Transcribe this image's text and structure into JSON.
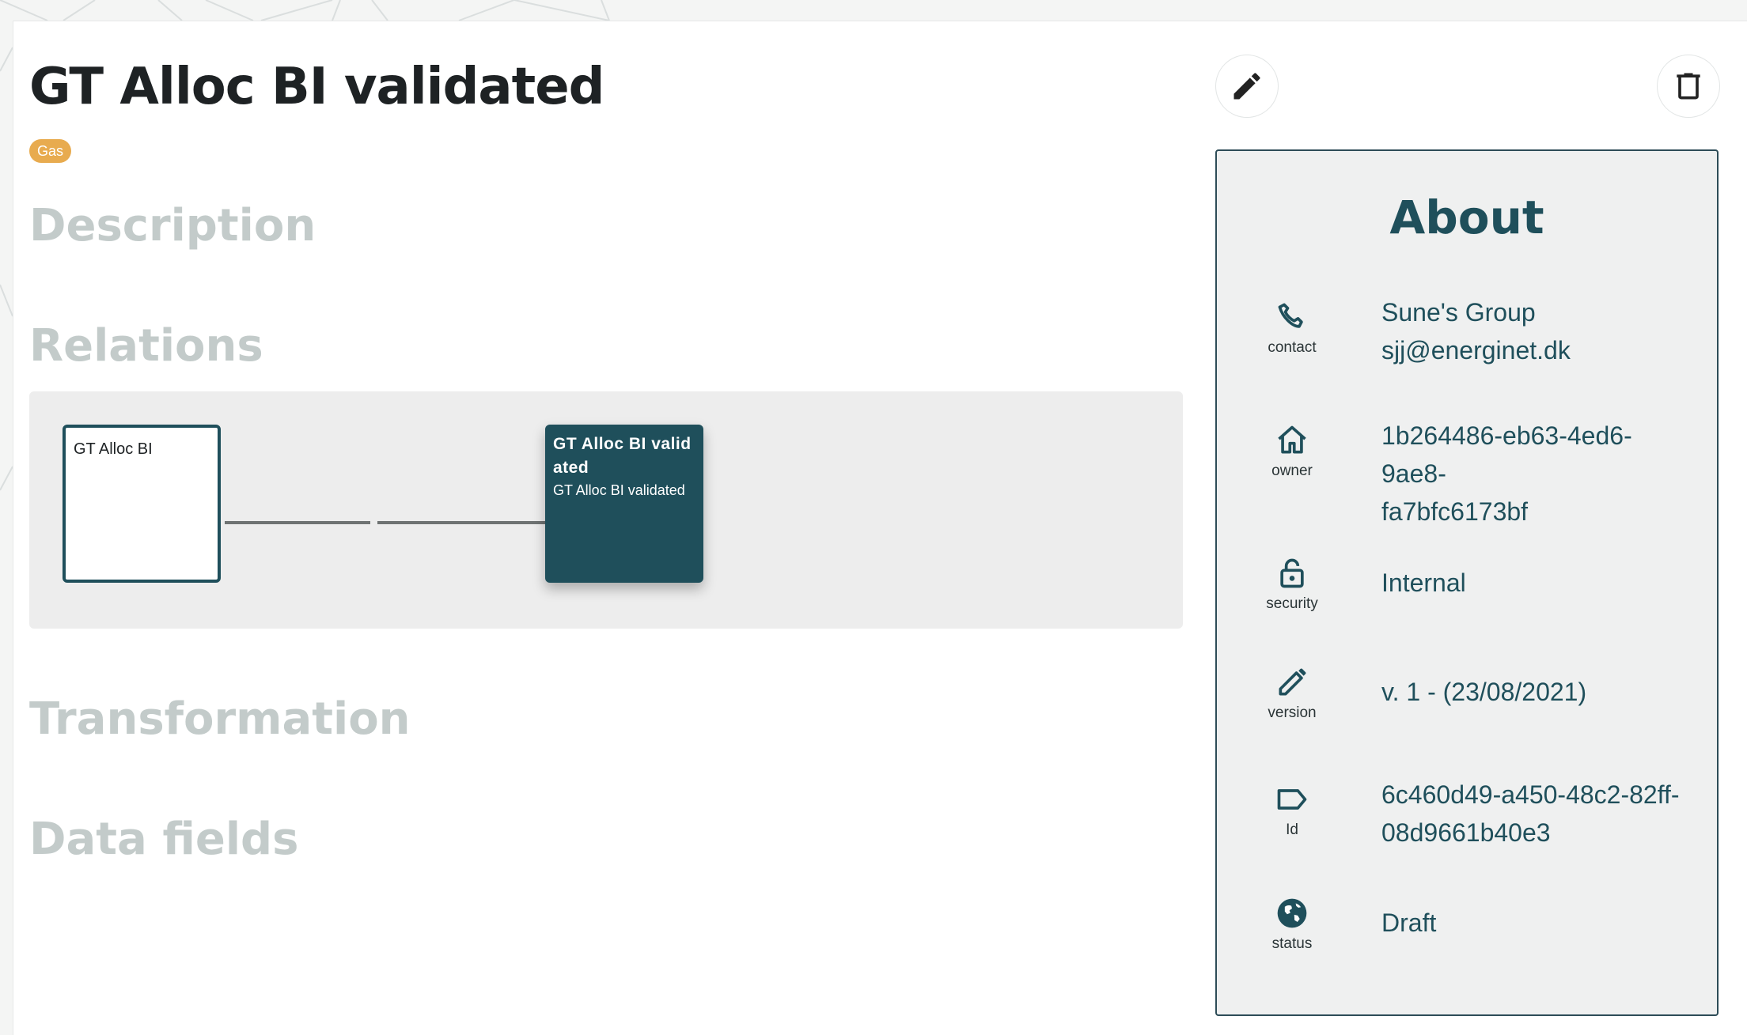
{
  "page": {
    "title": "GT Alloc BI validated",
    "tag": "Gas",
    "sections": {
      "description": "Description",
      "relations": "Relations",
      "transformation": "Transformation",
      "data_fields": "Data fields"
    }
  },
  "lineage": {
    "source_node": {
      "label": "GT Alloc BI"
    },
    "target_node": {
      "title": "GT Alloc BI validated",
      "subtitle": "GT Alloc BI validated"
    }
  },
  "actions": {
    "edit_icon": "pencil-icon",
    "delete_icon": "trash-icon"
  },
  "about": {
    "title": "About",
    "contact": {
      "label": "contact",
      "icon": "phone-icon",
      "line1": "Sune's Group",
      "line2": "sjj@energinet.dk"
    },
    "owner": {
      "label": "owner",
      "icon": "home-icon",
      "line1": "1b264486-eb63-4ed6-9ae8-",
      "line2": "fa7bfc6173bf"
    },
    "security": {
      "label": "security",
      "icon": "lock-open-icon",
      "value": "Internal"
    },
    "version": {
      "label": "version",
      "icon": "pencil-icon",
      "value": "v. 1 - (23/08/2021)"
    },
    "id": {
      "label": "Id",
      "icon": "tag-icon",
      "line1": "6c460d49-a450-48c2-82ff-",
      "line2": "08d9661b40e3"
    },
    "status": {
      "label": "status",
      "icon": "globe-icon",
      "value": "Draft"
    }
  },
  "colors": {
    "accent": "#1f4f5b",
    "tag": "#e8ab4f",
    "section_heading": "#c3cbca",
    "panel_bg": "#eff0f0"
  }
}
